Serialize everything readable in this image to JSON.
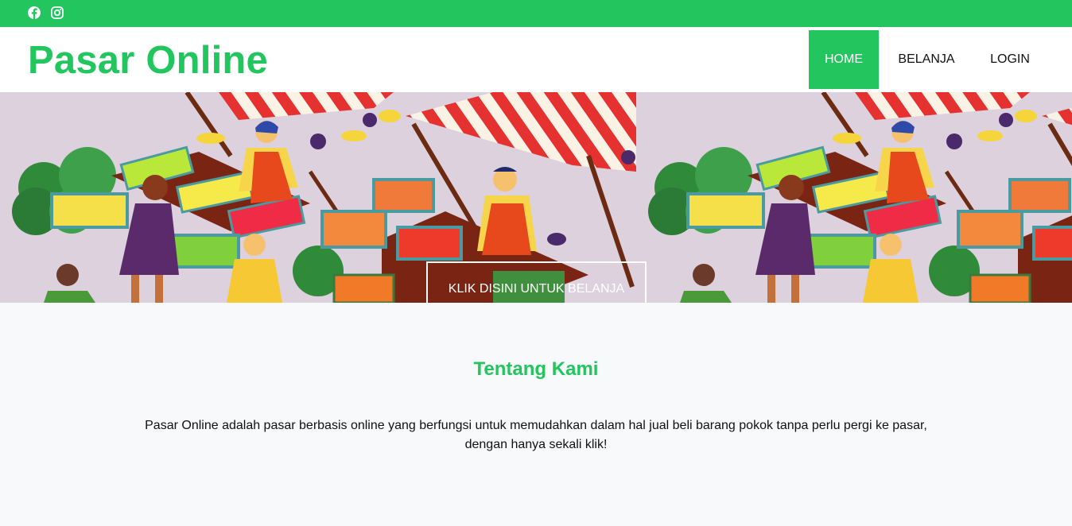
{
  "topbar": {
    "background": "#22c55e",
    "icons": [
      "facebook-icon",
      "instagram-icon"
    ]
  },
  "navbar": {
    "brand": "Pasar Online",
    "brand_color": "#22c55e",
    "items": [
      {
        "label": "HOME",
        "active": true
      },
      {
        "label": "BELANJA",
        "active": false
      },
      {
        "label": "LOGIN",
        "active": false
      }
    ]
  },
  "hero": {
    "button_label": "KLIK DISINI UNTUK BELANJA",
    "image": "market-illustration"
  },
  "about": {
    "title": "Tentang Kami",
    "text": "Pasar Online adalah pasar berbasis online yang berfungsi untuk memudahkan dalam hal jual beli barang pokok tanpa perlu pergi ke pasar, dengan hanya sekali klik!"
  }
}
